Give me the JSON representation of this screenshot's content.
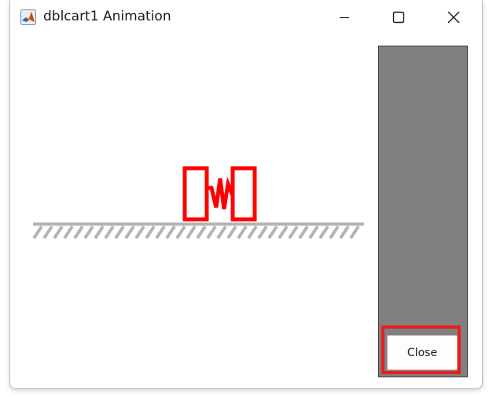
{
  "window": {
    "title": "dblcart1 Animation",
    "app_icon": "matlab-icon",
    "controls": {
      "minimize_icon": "minimize-icon",
      "maximize_icon": "maximize-icon",
      "close_icon": "close-icon"
    }
  },
  "side_panel": {
    "background_color": "#808080",
    "close_label": "Close",
    "highlight_color": "#ee1c1c"
  },
  "animation": {
    "cart_color": "#ff0000",
    "ground_color": "#b4b4b4"
  }
}
